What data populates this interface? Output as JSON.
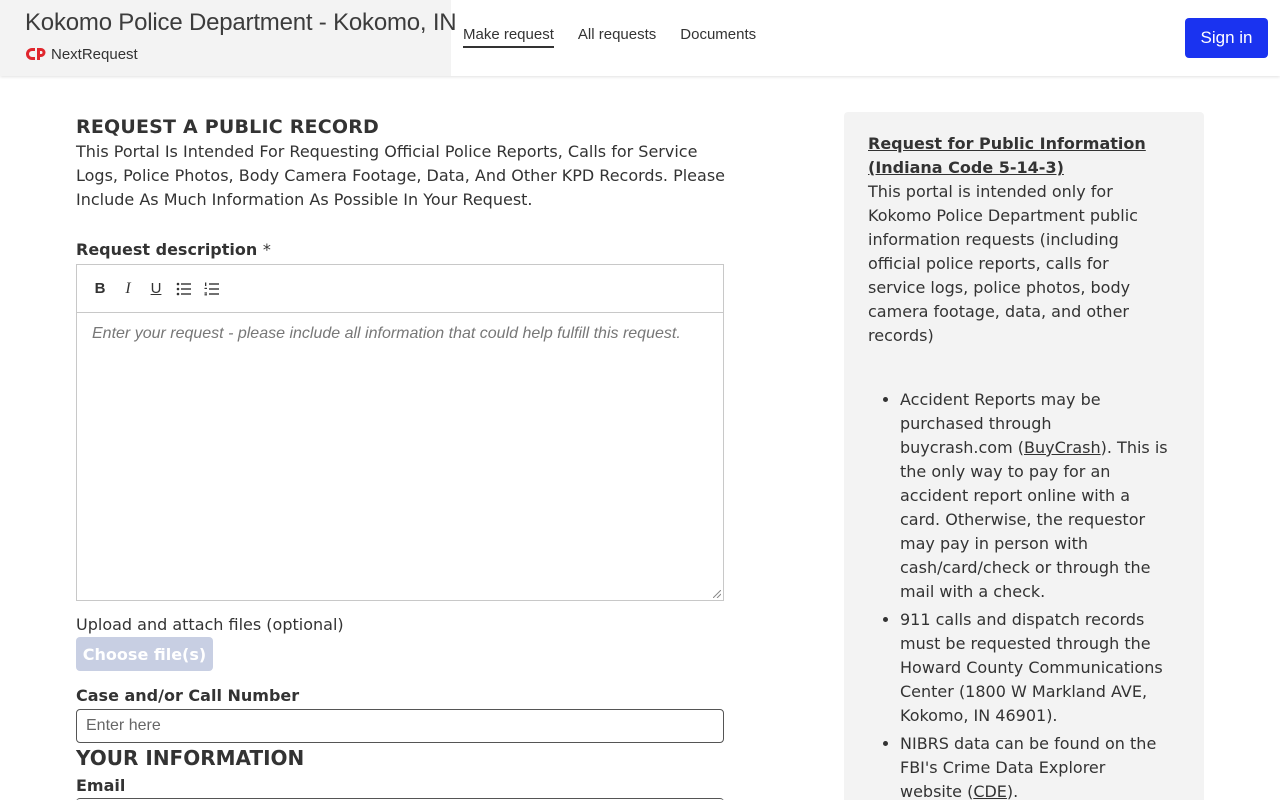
{
  "header": {
    "agency_name": "Kokomo Police Department - Kokomo, IN",
    "logo_text": "NextRequest",
    "nav": [
      {
        "label": "Make request",
        "active": true
      },
      {
        "label": "All requests",
        "active": false
      },
      {
        "label": "Documents",
        "active": false
      }
    ],
    "sign_in_label": "Sign in",
    "accent_color": "#1a33f0"
  },
  "form": {
    "title": "REQUEST A PUBLIC RECORD",
    "intro": "This Portal Is Intended For Requesting Official Police Reports, Calls for Service Logs, Police Photos, Body Camera Footage, Data, And Other KPD Records. Please Include As Much Information As Possible In Your Request.",
    "request_description_label": "Request description",
    "required_marker": "*",
    "editor_toolbar": [
      {
        "icon": "bold-icon",
        "glyph": "B"
      },
      {
        "icon": "italic-icon",
        "glyph": "I"
      },
      {
        "icon": "underline-icon",
        "glyph": "U"
      },
      {
        "icon": "bullet-list-icon"
      },
      {
        "icon": "numbered-list-icon"
      }
    ],
    "editor_placeholder": "Enter your request - please include all information that could help fulfill this request.",
    "upload_label": "Upload and attach files (optional)",
    "choose_files_label": "Choose file(s)",
    "case_label": "Case and/or Call Number",
    "case_placeholder": "Enter here",
    "your_information_heading": "YOUR INFORMATION",
    "email_label": "Email"
  },
  "sidebar": {
    "heading": "Request for Public Information (Indiana Code 5-14-3)",
    "intro": "This portal is intended only for Kokomo Police Department public information requests (including official police reports, calls for service logs, police photos, body camera footage, data, and other records)",
    "items": [
      {
        "before": "Accident Reports may be purchased through buycrash.com (",
        "link": "BuyCrash",
        "after": "). This is the only way to pay for an accident report online with a card. Otherwise, the requestor may pay in person with cash/card/check or through the mail with a check."
      },
      {
        "before": "911 calls and dispatch records must be requested through the Howard County Communications Center (1800 W Markland AVE, Kokomo, IN 46901).",
        "link": "",
        "after": ""
      },
      {
        "before": "NIBRS data can be found on the FBI's Crime Data Explorer website (",
        "link": "CDE",
        "after": ")."
      }
    ]
  }
}
